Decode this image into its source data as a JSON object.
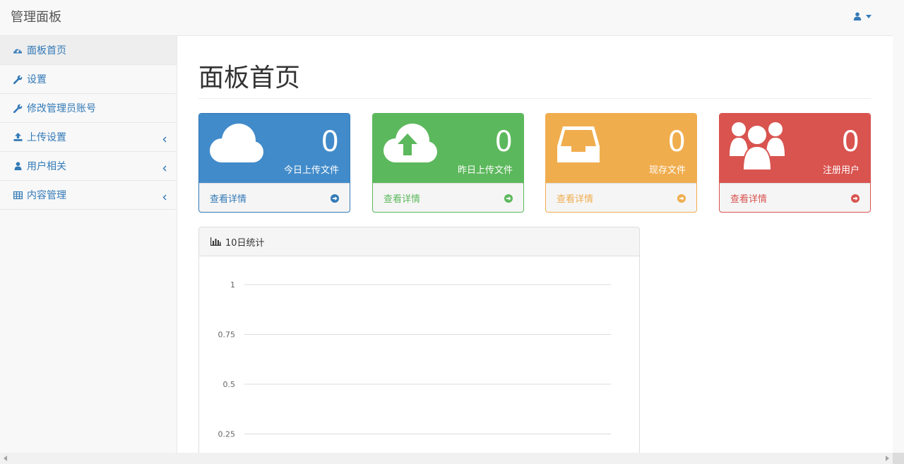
{
  "app": {
    "brand": "管理面板"
  },
  "sidebar": {
    "items": [
      {
        "label": "面板首页",
        "icon": "dashboard-icon",
        "active": true
      },
      {
        "label": "设置",
        "icon": "wrench-icon"
      },
      {
        "label": "修改管理员账号",
        "icon": "wrench-icon"
      },
      {
        "label": "上传设置",
        "icon": "upload-icon",
        "expandable": true
      },
      {
        "label": "用户相关",
        "icon": "user-icon",
        "expandable": true
      },
      {
        "label": "内容管理",
        "icon": "table-icon",
        "expandable": true
      }
    ]
  },
  "main": {
    "title": "面板首页",
    "panels": [
      {
        "count": "0",
        "label": "今日上传文件",
        "link": "查看详情",
        "icon": "cloud-icon",
        "color": "#428bca"
      },
      {
        "count": "0",
        "label": "昨日上传文件",
        "link": "查看详情",
        "icon": "cloud-upload-icon",
        "color": "#5cb85c"
      },
      {
        "count": "0",
        "label": "现存文件",
        "link": "查看详情",
        "icon": "inbox-icon",
        "color": "#f0ad4e"
      },
      {
        "count": "0",
        "label": "注册用户",
        "link": "查看详情",
        "icon": "users-icon",
        "color": "#d9534f"
      }
    ],
    "stats": {
      "title": "10日统计",
      "icon": "bar-chart-icon"
    }
  },
  "chart_data": {
    "type": "line",
    "title": "10日统计",
    "yticks": [
      "1",
      "0.75",
      "0.5",
      "0.25"
    ],
    "ylim": [
      0,
      1
    ],
    "grid": true
  }
}
